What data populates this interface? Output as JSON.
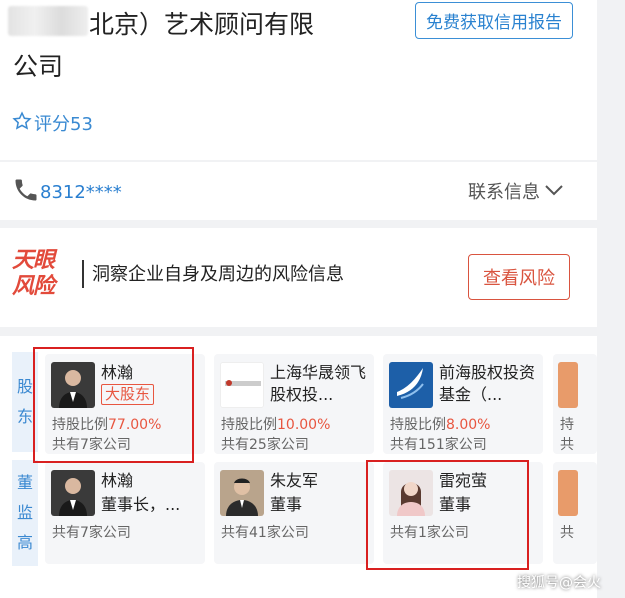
{
  "header": {
    "company_name_line1": "北京）艺术顾问有限",
    "company_name_line2": "公司",
    "report_button": "免费获取信用报告",
    "rating_label": "评分53"
  },
  "contact": {
    "phone": "8312****",
    "info_label": "联系信息"
  },
  "risk": {
    "logo_line1": "天眼",
    "logo_line2": "风险",
    "text": "洞察企业自身及周边的风险信息",
    "button": "查看风险"
  },
  "shareholders": {
    "label": [
      "股",
      "东"
    ],
    "items": [
      {
        "name": "林瀚",
        "tag": "大股东",
        "share_label": "持股比例",
        "share_value": "77.00%",
        "companies": "共有7家公司"
      },
      {
        "name": "上海华晟领飞股权投...",
        "share_label": "持股比例",
        "share_value": "10.00%",
        "companies": "共有25家公司"
      },
      {
        "name": "前海股权投资基金（...",
        "share_label": "持股比例",
        "share_value": "8.00%",
        "companies": "共有151家公司"
      }
    ],
    "partial_text": "持",
    "partial_text2": "共"
  },
  "executives": {
    "label": [
      "董",
      "监",
      "高"
    ],
    "items": [
      {
        "name": "林瀚",
        "role": "董事长，...",
        "companies": "共有7家公司"
      },
      {
        "name": "朱友军",
        "role": "董事",
        "companies": "共有41家公司"
      },
      {
        "name": "雷宛萤",
        "role": "董事",
        "companies": "共有1家公司"
      }
    ],
    "partial_text": "共"
  },
  "watermark": "搜狐号@会火",
  "colors": {
    "accent": "#2a82d0",
    "risk": "#d9543f",
    "highlight_box": "#d92020"
  }
}
